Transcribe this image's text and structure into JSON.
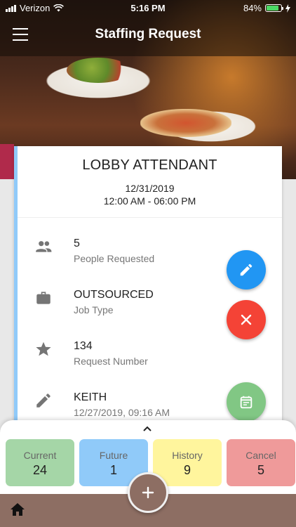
{
  "status_bar": {
    "carrier": "Verizon",
    "time": "5:16 PM",
    "battery_pct": "84%",
    "battery_level": 0.84
  },
  "header": {
    "title": "Staffing Request",
    "menu_icon": "hamburger-menu-icon"
  },
  "request": {
    "title": "LOBBY ATTENDANT",
    "date": "12/31/2019",
    "time_range": "12:00 AM - 06:00 PM",
    "details": [
      {
        "icon": "people-icon",
        "value": "5",
        "label": "People Requested"
      },
      {
        "icon": "briefcase-icon",
        "value": "OUTSOURCED",
        "label": "Job Type"
      },
      {
        "icon": "star-icon",
        "value": "134",
        "label": "Request Number"
      },
      {
        "icon": "pencil-icon",
        "value": "KEITH",
        "label": "12/27/2019, 09:16 AM"
      }
    ]
  },
  "actions": {
    "edit_icon": "pencil-icon",
    "cancel_icon": "close-icon",
    "calendar_icon": "calendar-icon"
  },
  "tabs": [
    {
      "label": "Current",
      "count": "24",
      "color": "#a5d6a7"
    },
    {
      "label": "Future",
      "count": "1",
      "color": "#90caf9"
    },
    {
      "label": "History",
      "count": "9",
      "color": "#fff59d"
    },
    {
      "label": "Cancel",
      "count": "5",
      "color": "#ef9a9a"
    }
  ],
  "colors": {
    "accent_blue": "#2196f3",
    "accent_red": "#f44336",
    "accent_green": "#81c784",
    "bottom_bar": "#8d6e63",
    "card_stripe": "#90caf9"
  }
}
